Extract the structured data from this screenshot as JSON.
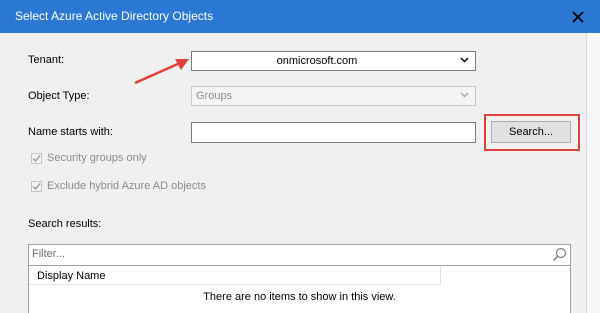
{
  "window": {
    "title": "Select Azure Active Directory Objects"
  },
  "form": {
    "tenant_label": "Tenant:",
    "tenant_value": "onmicrosoft.com",
    "object_type_label": "Object Type:",
    "object_type_value": "Groups",
    "name_label": "Name starts with:",
    "name_value": "",
    "search_button": "Search...",
    "security_groups_only": "Security groups only",
    "exclude_hybrid": "Exclude hybrid Azure AD objects"
  },
  "results": {
    "label": "Search results:",
    "filter_placeholder": "Filter...",
    "column_display_name": "Display Name",
    "empty_message": "There are no items to show in this view."
  },
  "colors": {
    "titlebar": "#2b78d4",
    "annotation_red": "#e0403a"
  }
}
